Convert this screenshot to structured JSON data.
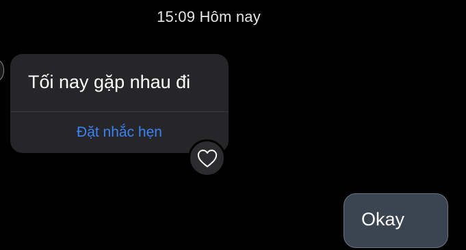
{
  "header": {
    "timestamp": "15:09 Hôm nay"
  },
  "messages": {
    "incoming": {
      "text": "Tối nay gặp nhau đi",
      "action_label": "Đặt nhắc hẹn",
      "reaction_icon": "heart-outline-icon"
    },
    "outgoing": {
      "text": "Okay"
    }
  },
  "colors": {
    "background": "#000000",
    "incoming_bubble": "#262628",
    "outgoing_bubble": "#3b4451",
    "link": "#3b82f6"
  }
}
